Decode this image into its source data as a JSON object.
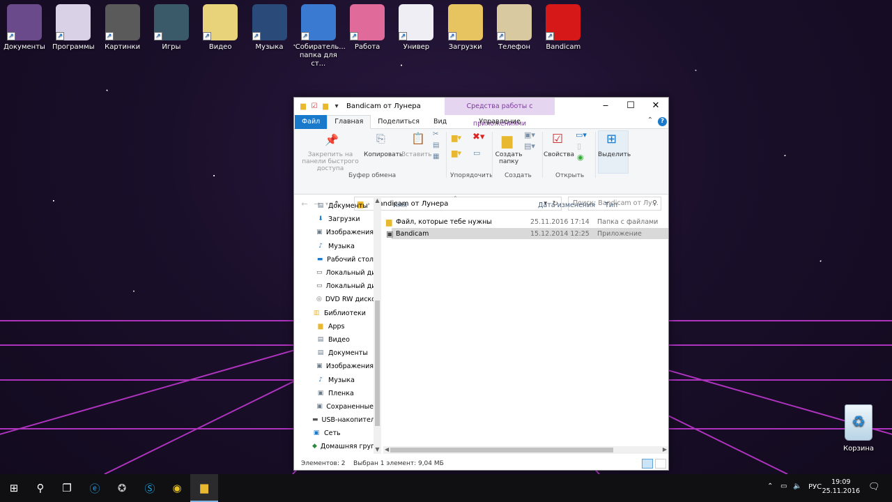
{
  "desktop": {
    "icons": [
      {
        "label": "Документы",
        "color": "#6a4a8a"
      },
      {
        "label": "Программы",
        "color": "#d9d2e6"
      },
      {
        "label": "Картинки",
        "color": "#5a5a5a"
      },
      {
        "label": "Игры",
        "color": "#3a5a6a"
      },
      {
        "label": "Видео",
        "color": "#e8d27a"
      },
      {
        "label": "Музыка",
        "color": "#2a4a7a"
      },
      {
        "label": "Собиратель... папка для ст...",
        "color": "#3a7ad0"
      },
      {
        "label": "Работа",
        "color": "#e06a9a"
      },
      {
        "label": "Универ",
        "color": "#f0eef5"
      },
      {
        "label": "Загрузки",
        "color": "#e8c460"
      },
      {
        "label": "Телефон",
        "color": "#d9c9a0"
      },
      {
        "label": "Bandicam",
        "color": "#d61818"
      }
    ],
    "recycle_bin": "Корзина"
  },
  "window": {
    "title": "Bandicam от Лунера",
    "context_tab_group": "Средства работы с приложениями",
    "tabs": {
      "file": "Файл",
      "home": "Главная",
      "share": "Поделиться",
      "view": "Вид",
      "manage": "Управление"
    },
    "ribbon": {
      "pin_quick_access": "Закрепить на панели быстрого доступа",
      "copy": "Копировать",
      "paste": "Вставить",
      "new_folder": "Создать папку",
      "properties": "Свойства",
      "select": "Выделить",
      "groups": {
        "clipboard": "Буфер обмена",
        "organize": "Упорядочить",
        "create": "Создать",
        "open": "Открыть"
      }
    },
    "address": {
      "path": "Bandicam от Лунера",
      "search_placeholder": "Поиск: Bandicam от Лу..."
    },
    "nav_pane": [
      {
        "label": "Документы",
        "icon": "documents-icon",
        "indent": 1
      },
      {
        "label": "Загрузки",
        "icon": "downloads-icon",
        "indent": 1
      },
      {
        "label": "Изображения",
        "icon": "pictures-icon",
        "indent": 1
      },
      {
        "label": "Музыка",
        "icon": "music-icon",
        "indent": 1
      },
      {
        "label": "Рабочий стол",
        "icon": "desktop-icon",
        "indent": 1
      },
      {
        "label": "Локальный ди",
        "icon": "drive-icon",
        "indent": 1
      },
      {
        "label": "Локальный ди",
        "icon": "drive-icon",
        "indent": 1
      },
      {
        "label": "DVD RW диско",
        "icon": "dvd-icon",
        "indent": 1
      },
      {
        "label": "Библиотеки",
        "icon": "libraries-icon",
        "indent": 0
      },
      {
        "label": "Apps",
        "icon": "apps-icon",
        "indent": 1
      },
      {
        "label": "Видео",
        "icon": "videos-icon",
        "indent": 1
      },
      {
        "label": "Документы",
        "icon": "documents-icon",
        "indent": 1
      },
      {
        "label": "Изображения",
        "icon": "pictures-icon",
        "indent": 1
      },
      {
        "label": "Музыка",
        "icon": "music-icon",
        "indent": 1
      },
      {
        "label": "Пленка",
        "icon": "camera-roll-icon",
        "indent": 1
      },
      {
        "label": "Сохраненные",
        "icon": "saved-pictures-icon",
        "indent": 1
      },
      {
        "label": "USB-накопители",
        "icon": "usb-icon",
        "indent": 0
      },
      {
        "label": "Сеть",
        "icon": "network-icon",
        "indent": 0
      },
      {
        "label": "Домашняя груп",
        "icon": "homegroup-icon",
        "indent": 0
      }
    ],
    "columns": {
      "name": "Имя",
      "date": "Дата изменения",
      "type": "Тип"
    },
    "files": [
      {
        "name": "Файл, которые тебе нужны",
        "date": "25.11.2016 17:14",
        "type": "Папка с файлами",
        "icon": "folder-icon",
        "selected": false
      },
      {
        "name": "Bandicam",
        "date": "15.12.2014 12:25",
        "type": "Приложение",
        "icon": "app-icon",
        "selected": true
      }
    ],
    "status": {
      "count": "Элементов: 2",
      "selection": "Выбран 1 элемент: 9,04 МБ"
    }
  },
  "taskbar": {
    "language": "РУС",
    "time": "19:09",
    "date": "25.11.2016"
  }
}
